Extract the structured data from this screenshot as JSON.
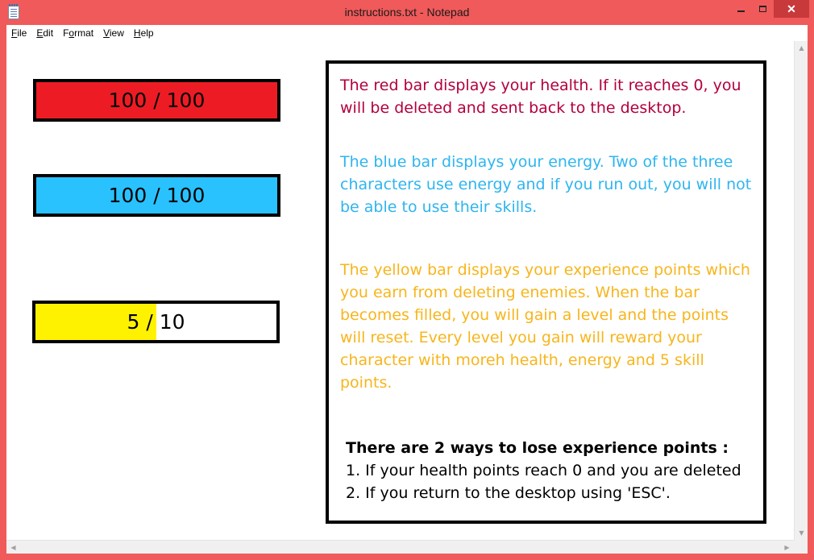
{
  "window": {
    "title": "instructions.txt - Notepad",
    "controls": {
      "minimize": "minimize",
      "maximize": "maximize",
      "close": "✕"
    }
  },
  "menu": {
    "items": [
      {
        "label": "File",
        "mnemonic": "F",
        "rest": "ile"
      },
      {
        "label": "Edit",
        "mnemonic": "E",
        "rest": "dit"
      },
      {
        "label": "Format",
        "mnemonic": "o",
        "prefix": "F",
        "rest": "rmat"
      },
      {
        "label": "View",
        "mnemonic": "V",
        "rest": "iew"
      },
      {
        "label": "Help",
        "mnemonic": "H",
        "rest": "elp"
      }
    ]
  },
  "bars": {
    "health": {
      "text": "100 / 100",
      "value": 100,
      "max": 100,
      "color": "#ed1c24"
    },
    "energy": {
      "text": "100 / 100",
      "value": 100,
      "max": 100,
      "color": "#29c2ff"
    },
    "experience": {
      "text": "5 / 10",
      "value": 5,
      "max": 10,
      "color": "#fff200"
    }
  },
  "instructions": {
    "health": "The red bar displays your health. If it reaches 0, you will be deleted and sent back to the desktop.",
    "energy": "The blue bar displays your energy. Two of the three characters use energy and if you run out, you will not be able to use their skills.",
    "experience": "The yellow bar displays your experience points which you earn from deleting enemies. When the bar becomes filled, you will gain a level and the points will reset. Every level you gain will reward your character with moreh health, energy and 5 skill points.",
    "lose_title": "There are 2 ways to lose experience points :",
    "lose_1": "1. If your health points reach 0 and you are deleted",
    "lose_2": "2. If you return to the desktop using 'ESC'."
  },
  "colors": {
    "frame": "#f05a5a",
    "health_text": "#b3003b",
    "energy_text": "#2eb5ef",
    "experience_text": "#f7b51c"
  }
}
